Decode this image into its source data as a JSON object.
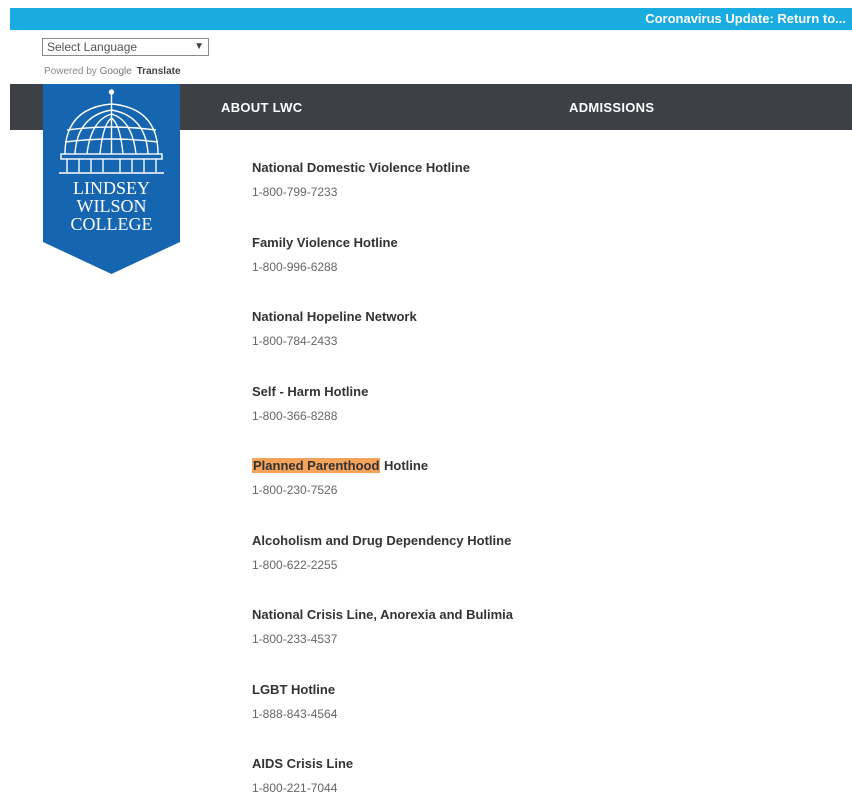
{
  "banner": {
    "text": "Coronavirus Update: Return to..."
  },
  "translate": {
    "select_label": "Select Language",
    "powered_by": "Powered by",
    "google": "Google",
    "translate": "Translate"
  },
  "nav": {
    "items": [
      {
        "label": "ABOUT LWC"
      },
      {
        "label": "ADMISSIONS"
      }
    ]
  },
  "logo": {
    "line1": "LINDSEY",
    "line2": "WILSON",
    "line3": "COLLEGE",
    "color": "#1565b0"
  },
  "hotlines": [
    {
      "title": "National Domestic Violence Hotline",
      "phone": "1-800-799-7233"
    },
    {
      "title": "Family Violence Hotline",
      "phone": "1-800-996-6288"
    },
    {
      "title": "National Hopeline Network",
      "phone": "1-800-784-2433"
    },
    {
      "title": "Self - Harm Hotline",
      "phone": "1-800-366-8288"
    },
    {
      "title_highlight": "Planned Parenthood",
      "title_rest": " Hotline",
      "phone": "1-800-230-7526"
    },
    {
      "title": "Alcoholism and Drug Dependency Hotline",
      "phone": "1-800-622-2255"
    },
    {
      "title": "National Crisis Line, Anorexia and Bulimia",
      "phone": "1-800-233-4537"
    },
    {
      "title": "LGBT Hotline",
      "phone": "1-888-843-4564"
    },
    {
      "title": "AIDS Crisis Line",
      "phone": "1-800-221-7044"
    }
  ],
  "colors": {
    "banner": "#1aabe0",
    "navbar": "#3d4045",
    "highlight": "#f5a25a"
  }
}
